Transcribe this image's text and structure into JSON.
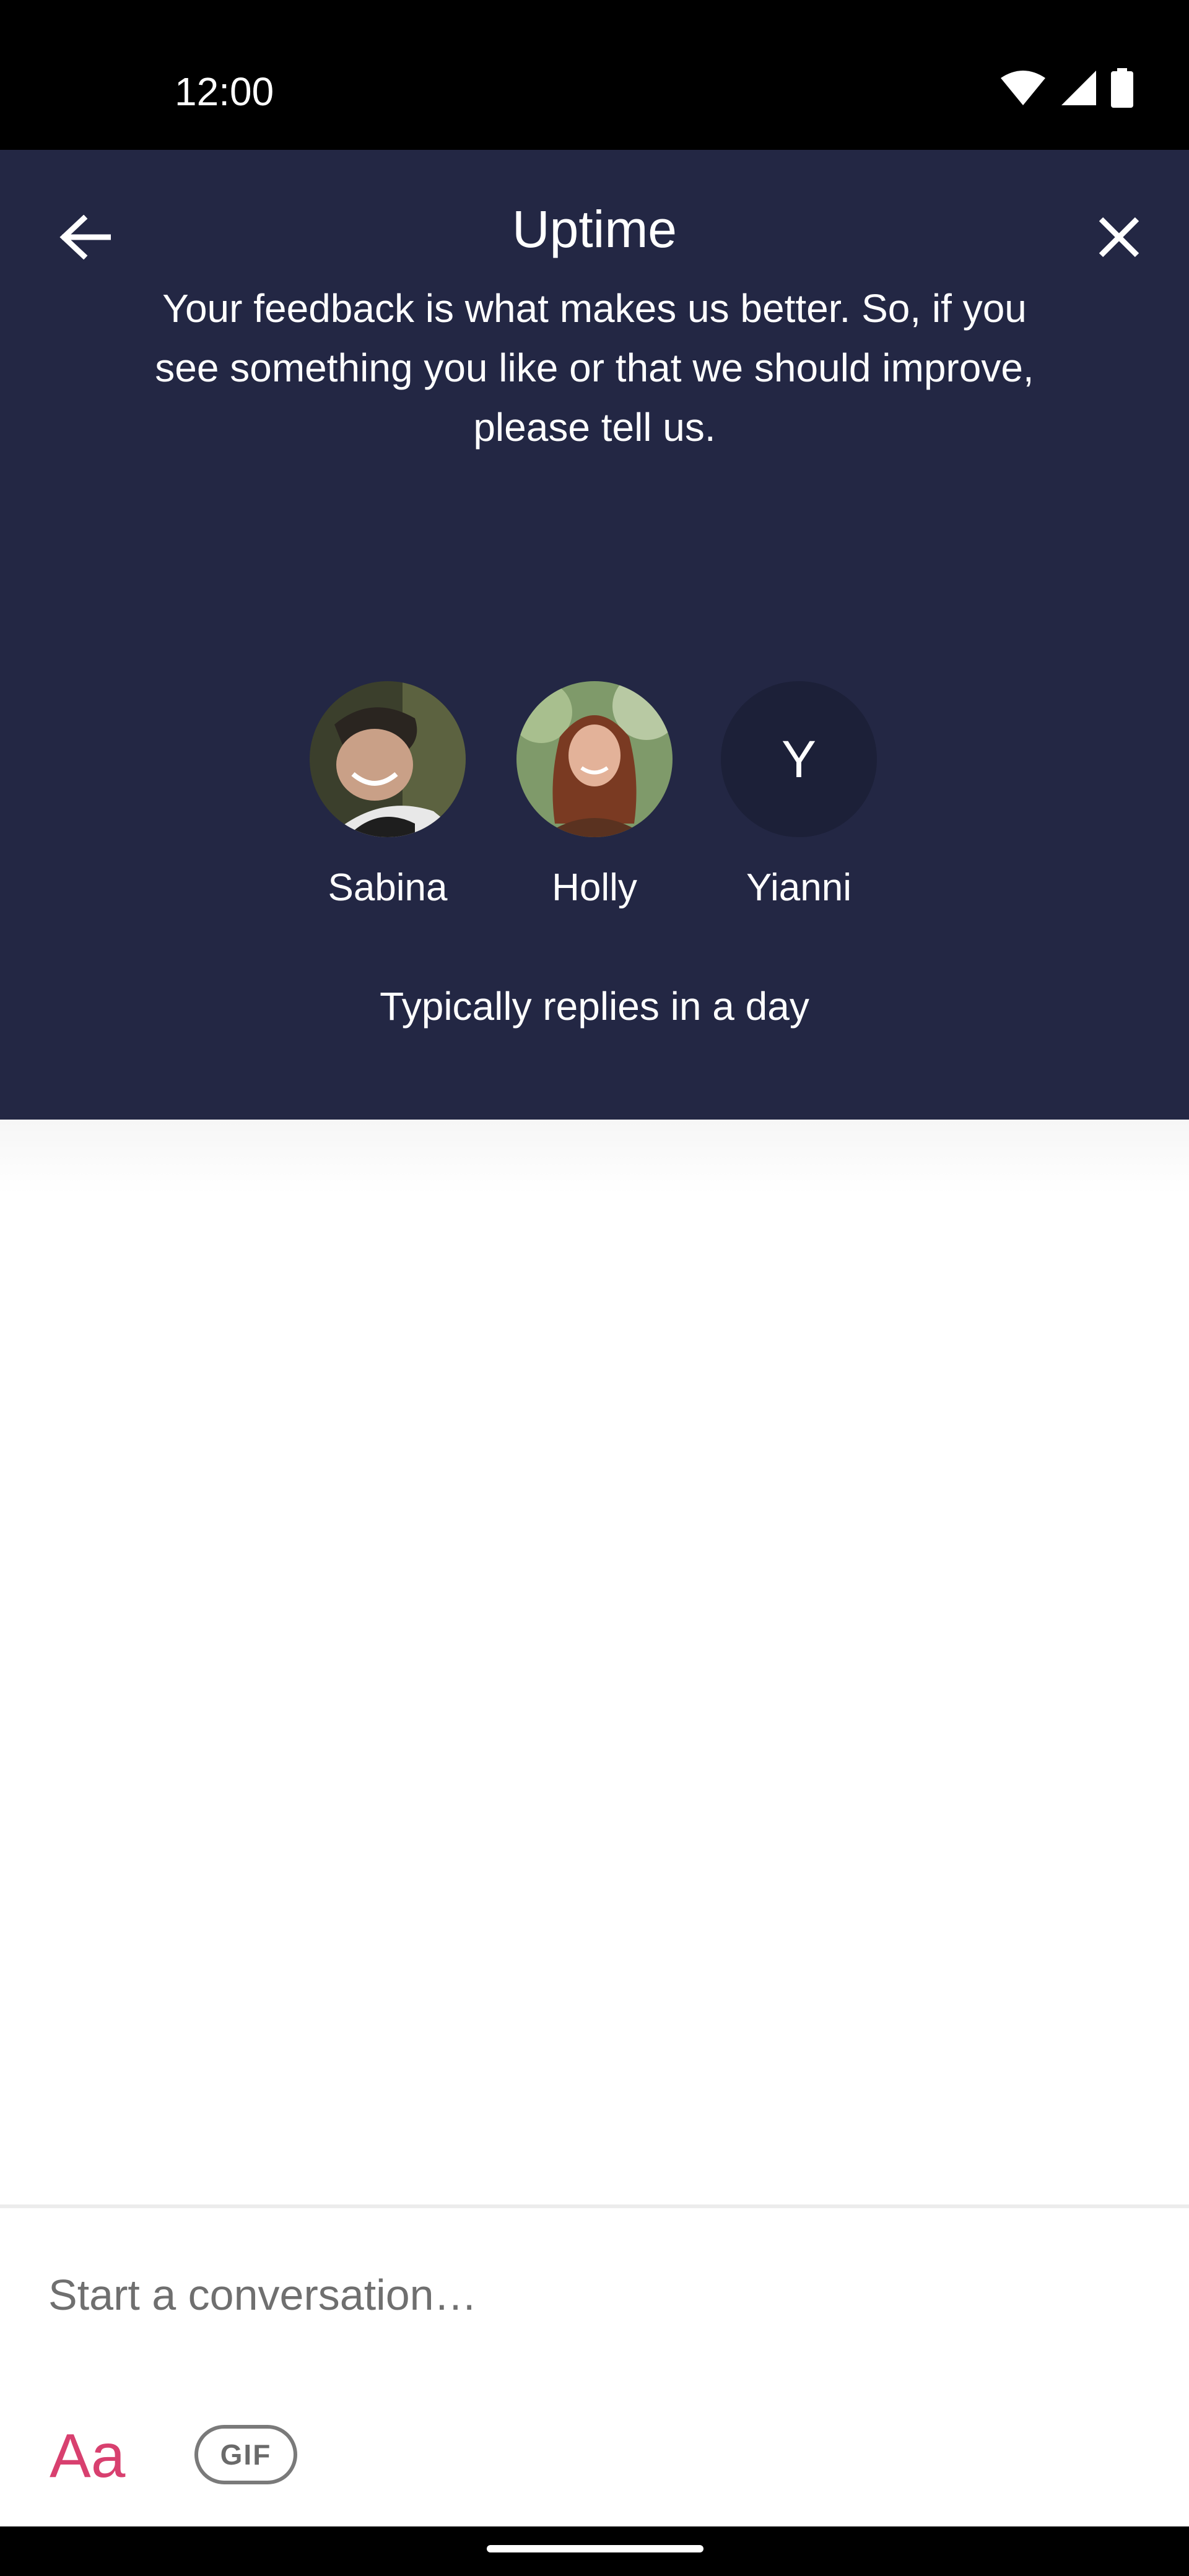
{
  "status_bar": {
    "time": "12:00",
    "icons": [
      "wifi-icon",
      "cellular-signal-icon",
      "battery-icon"
    ]
  },
  "header": {
    "back_icon": "arrow-left-icon",
    "close_icon": "close-icon",
    "title": "Uptime",
    "description": "Your feedback is what makes us better. So, if you see something you like or that we should improve, please tell us.",
    "team": [
      {
        "name": "Sabina",
        "avatar": "photo"
      },
      {
        "name": "Holly",
        "avatar": "photo"
      },
      {
        "name": "Yianni",
        "avatar_letter": "Y"
      }
    ],
    "reply_time": "Typically replies in a day"
  },
  "composer": {
    "placeholder": "Start a conversation…",
    "format_label": "Aa",
    "gif_label": "GIF"
  },
  "colors": {
    "header_bg": "#232744",
    "avatar_letter_bg": "#1c2038",
    "accent": "#d8406f"
  }
}
